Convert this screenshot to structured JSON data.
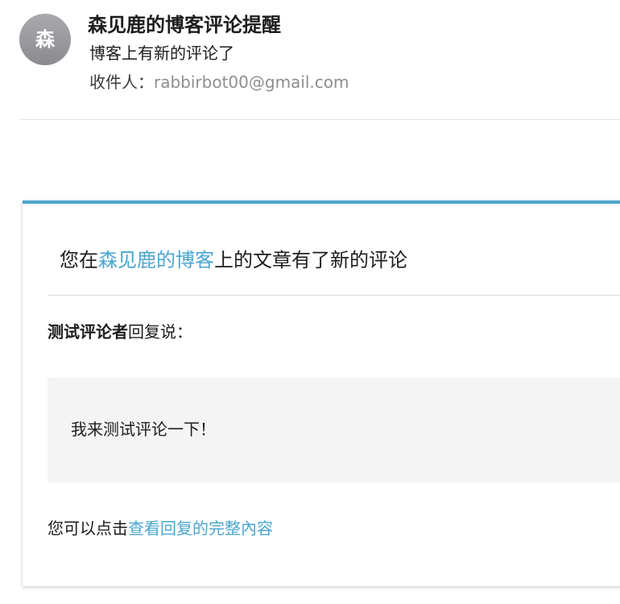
{
  "header": {
    "avatar_initial": "森",
    "sender": "森见鹿的博客评论提醒",
    "subject": "博客上有新的评论了",
    "recipient_label": "收件人：",
    "recipient_address": "rabbirbot00@gmail.com"
  },
  "card": {
    "title_prefix": "您在",
    "blog_link": "森见鹿的博客",
    "title_suffix": "上的文章有了新的评论",
    "comment_author": "测试评论者",
    "reply_says": "回复说：",
    "comment_text": "我来测试评论一下！",
    "footer_prefix": "您可以点击",
    "footer_link": "查看回复的完整內容"
  },
  "colors": {
    "accent": "#4aa6d0",
    "avatar": "#9a9a9f",
    "quote_bg": "#f4f4f4"
  }
}
